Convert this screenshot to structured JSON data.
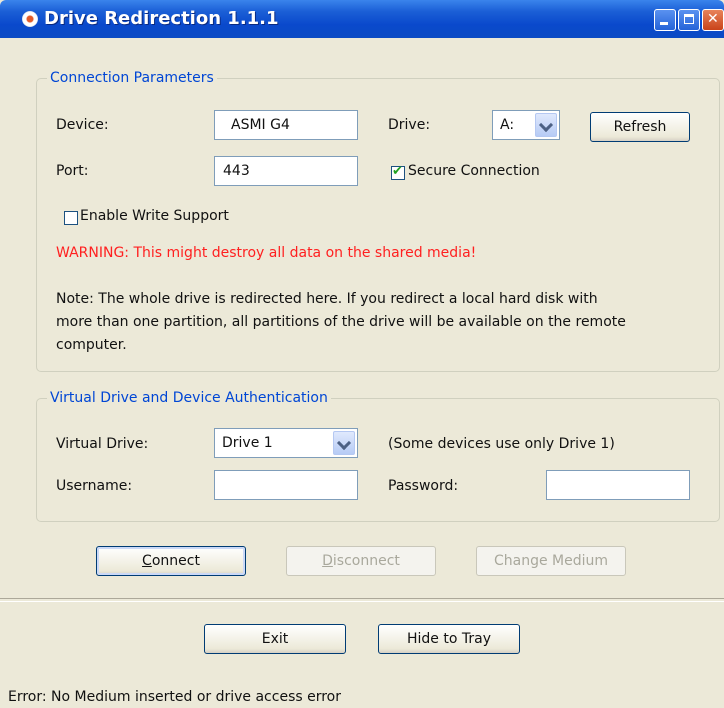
{
  "window": {
    "title": "Drive Redirection 1.1.1"
  },
  "connection": {
    "group_label": "Connection Parameters",
    "device_label": "Device:",
    "device_value": "ASMI G4",
    "drive_label": "Drive:",
    "drive_value": "A:",
    "refresh_label": "Refresh",
    "port_label": "Port:",
    "port_value": "443",
    "secure_label": "Secure Connection",
    "secure_checked": true,
    "write_label": "Enable Write Support",
    "write_checked": false,
    "warning": "WARNING: This might destroy all data on the shared media!",
    "note_line1": "Note: The whole drive is redirected here. If you redirect a local hard disk with",
    "note_line2": "more than one partition, all partitions of the drive will be available on the remote",
    "note_line3": "computer."
  },
  "virtual_drive": {
    "group_label": "Virtual Drive and Device Authentication",
    "vd_label": "Virtual Drive:",
    "vd_value": "Drive 1",
    "vd_hint": "(Some devices use only Drive 1)",
    "username_label": "Username:",
    "username_value": "",
    "password_label": "Password:",
    "password_value": ""
  },
  "actions": {
    "connect_first": "C",
    "connect_rest": "onnect",
    "disconnect_first": "D",
    "disconnect_rest": "isconnect",
    "change_medium": "Change Medium",
    "exit": "Exit",
    "hide_to_tray": "Hide to Tray"
  },
  "status": {
    "text": "Error: No Medium inserted or drive access error"
  },
  "colors": {
    "titlebar": "#0a49cc",
    "group_label": "#0046d5",
    "warning": "#ff2020",
    "window_bg": "#ece9d8"
  }
}
